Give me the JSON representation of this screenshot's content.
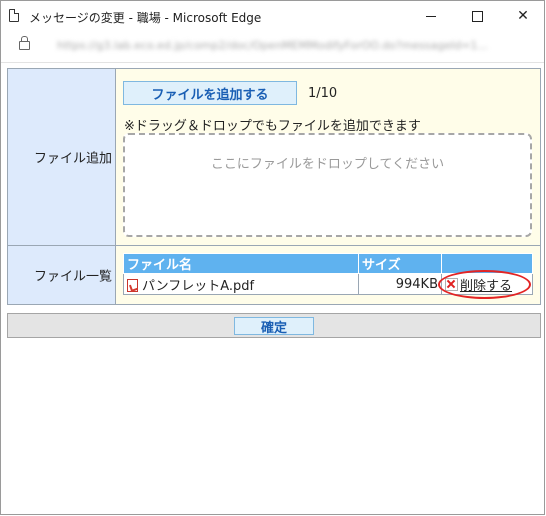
{
  "window": {
    "title": "メッセージの変更 - 職場 - Microsoft Edge",
    "url": "https://g3.lab.eco.ed.jp/comp2/doc/OpenMEMModifyForOO.do?messageId=1..."
  },
  "form": {
    "file_add": {
      "label": "ファイル追加",
      "button": "ファイルを追加する",
      "count": "1/10",
      "note": "※ドラッグ＆ドロップでもファイルを追加できます",
      "dropzone_text": "ここにファイルをドロップしてください"
    },
    "file_list": {
      "label": "ファイル一覧",
      "columns": [
        "ファイル名",
        "サイズ",
        ""
      ],
      "rows": [
        {
          "name": "パンフレットA.pdf",
          "size": "994KB",
          "action": "削除する",
          "icon": "pdf-icon"
        }
      ]
    }
  },
  "actions": {
    "confirm": "確定"
  },
  "colors": {
    "label_bg": "#ddeafc",
    "value_bg": "#fffde9",
    "header_bg": "#5fb2ef",
    "highlight_ring": "#e32424"
  }
}
